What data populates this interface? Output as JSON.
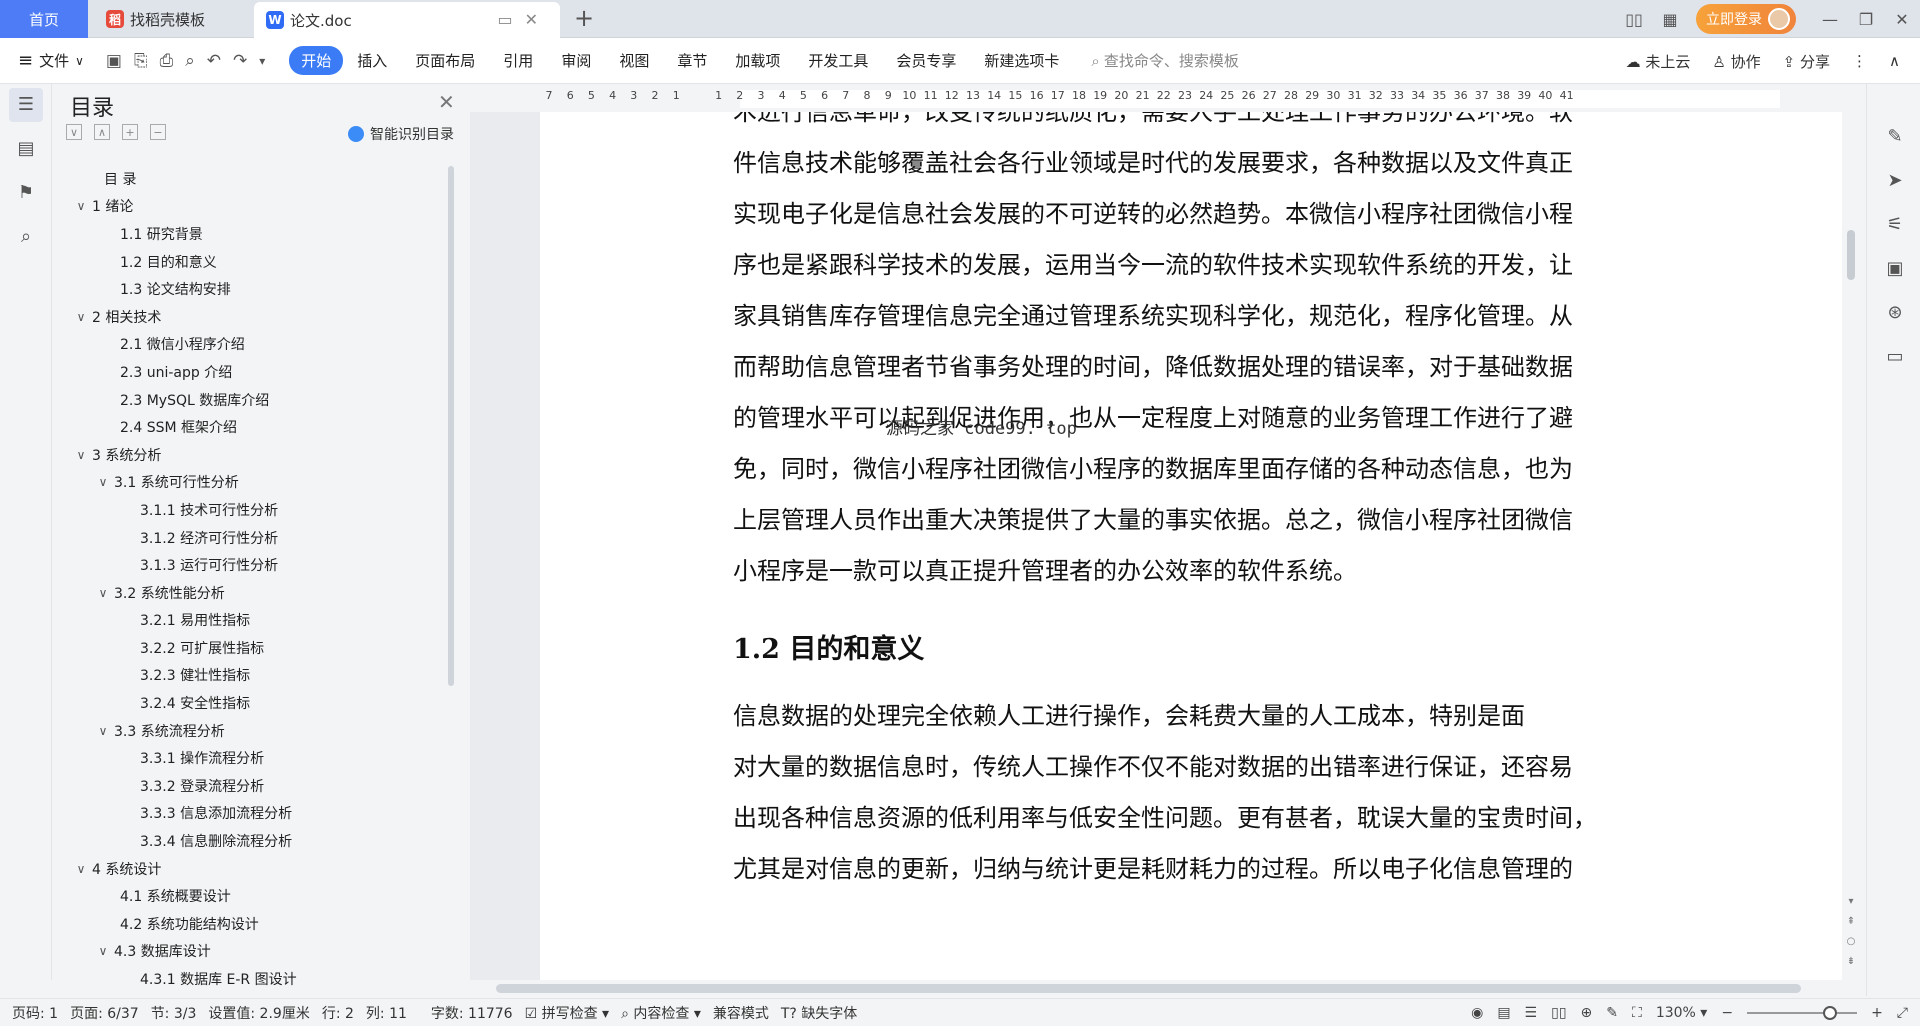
{
  "tabs": {
    "home": "首页",
    "template": "找稻壳模板",
    "document": "论文.doc"
  },
  "window": {
    "login": "立即登录"
  },
  "menu": {
    "file": "文件",
    "items": [
      "开始",
      "插入",
      "页面布局",
      "引用",
      "审阅",
      "视图",
      "章节",
      "加载项",
      "开发工具",
      "会员专享",
      "新建选项卡"
    ],
    "search_placeholder": "查找命令、搜索模板",
    "cloud": "未上云",
    "collab": "协作",
    "share": "分享"
  },
  "toc": {
    "title": "目录",
    "ai_label": "智能识别目录",
    "items": [
      {
        "text": "目  录",
        "level": 0,
        "arrow": ""
      },
      {
        "text": "1  绪论",
        "level": 0,
        "arrow": "∨"
      },
      {
        "text": "1.1  研究背景",
        "level": 1,
        "arrow": ""
      },
      {
        "text": "1.2  目的和意义",
        "level": 1,
        "arrow": ""
      },
      {
        "text": "1.3  论文结构安排",
        "level": 1,
        "arrow": ""
      },
      {
        "text": "2  相关技术",
        "level": 0,
        "arrow": "∨"
      },
      {
        "text": "2.1  微信小程序介绍",
        "level": 1,
        "arrow": ""
      },
      {
        "text": "2.3 uni-app 介绍",
        "level": 1,
        "arrow": ""
      },
      {
        "text": "2.3 MySQL 数据库介绍",
        "level": 1,
        "arrow": ""
      },
      {
        "text": "2.4 SSM 框架介绍",
        "level": 1,
        "arrow": ""
      },
      {
        "text": "3  系统分析",
        "level": 0,
        "arrow": "∨"
      },
      {
        "text": "3.1  系统可行性分析",
        "level": 1,
        "arrow": "∨"
      },
      {
        "text": "3.1.1  技术可行性分析",
        "level": 2,
        "arrow": ""
      },
      {
        "text": "3.1.2  经济可行性分析",
        "level": 2,
        "arrow": ""
      },
      {
        "text": "3.1.3  运行可行性分析",
        "level": 2,
        "arrow": ""
      },
      {
        "text": "3.2  系统性能分析",
        "level": 1,
        "arrow": "∨"
      },
      {
        "text": "3.2.1  易用性指标",
        "level": 2,
        "arrow": ""
      },
      {
        "text": "3.2.2  可扩展性指标",
        "level": 2,
        "arrow": ""
      },
      {
        "text": "3.2.3  健壮性指标",
        "level": 2,
        "arrow": ""
      },
      {
        "text": "3.2.4  安全性指标",
        "level": 2,
        "arrow": ""
      },
      {
        "text": "3.3  系统流程分析",
        "level": 1,
        "arrow": "∨"
      },
      {
        "text": "3.3.1  操作流程分析",
        "level": 2,
        "arrow": ""
      },
      {
        "text": "3.3.2  登录流程分析",
        "level": 2,
        "arrow": ""
      },
      {
        "text": "3.3.3  信息添加流程分析",
        "level": 2,
        "arrow": ""
      },
      {
        "text": "3.3.4  信息删除流程分析",
        "level": 2,
        "arrow": ""
      },
      {
        "text": "4  系统设计",
        "level": 0,
        "arrow": "∨"
      },
      {
        "text": "4.1  系统概要设计",
        "level": 1,
        "arrow": ""
      },
      {
        "text": "4.2  系统功能结构设计",
        "level": 1,
        "arrow": ""
      },
      {
        "text": "4.3  数据库设计",
        "level": 1,
        "arrow": "∨"
      },
      {
        "text": "4.3.1  数据库 E-R 图设计",
        "level": 2,
        "arrow": ""
      }
    ]
  },
  "ruler": [
    "7",
    "6",
    "5",
    "4",
    "3",
    "2",
    "1",
    "",
    "1",
    "2",
    "3",
    "4",
    "5",
    "6",
    "7",
    "8",
    "9",
    "10",
    "11",
    "12",
    "13",
    "14",
    "15",
    "16",
    "17",
    "18",
    "19",
    "20",
    "21",
    "22",
    "23",
    "24",
    "25",
    "26",
    "27",
    "28",
    "29",
    "30",
    "31",
    "32",
    "33",
    "34",
    "35",
    "36",
    "37",
    "38",
    "39",
    "40",
    "41"
  ],
  "document": {
    "para1": [
      "术进行信息革命，改变传统的纸质化，需要人手工处理工作事务的办公环境。软",
      "件信息技术能够覆盖社会各行业领域是时代的发展要求，各种数据以及文件真正",
      "实现电子化是信息社会发展的不可逆转的必然趋势。本微信小程序社团微信小程",
      "序也是紧跟科学技术的发展，运用当今一流的软件技术实现软件系统的开发，让",
      "家具销售库存管理信息完全通过管理系统实现科学化，规范化，程序化管理。从",
      "而帮助信息管理者节省事务处理的时间，降低数据处理的错误率，对于基础数据",
      "的管理水平可以起到促进作用，也从一定程度上对随意的业务管理工作进行了避",
      "免，同时，微信小程序社团微信小程序的数据库里面存储的各种动态信息，也为",
      "上层管理人员作出重大决策提供了大量的事实依据。总之，微信小程序社团微信",
      "小程序是一款可以真正提升管理者的办公效率的软件系统。"
    ],
    "heading": "1.2  目的和意义",
    "para2": [
      "    信息数据的处理完全依赖人工进行操作，会耗费大量的人工成本，特别是面",
      "对大量的数据信息时，传统人工操作不仅不能对数据的出错率进行保证，还容易",
      "出现各种信息资源的低利用率与低安全性问题。更有甚者，耽误大量的宝贵时间，",
      "尤其是对信息的更新，归纳与统计更是耗财耗力的过程。所以电子化信息管理的"
    ],
    "watermark": "源码之家 code99. top"
  },
  "status": {
    "page_code": "页码: 1",
    "page": "页面: 6/37",
    "section": "节: 3/3",
    "setting": "设置值: 2.9厘米",
    "row": "行: 2",
    "col": "列: 11",
    "words": "字数: 11776",
    "spell": "拼写检查",
    "content_check": "内容检查",
    "compat": "兼容模式",
    "missing_font": "缺失字体",
    "zoom": "130%",
    "zoom_level": 0.75
  }
}
